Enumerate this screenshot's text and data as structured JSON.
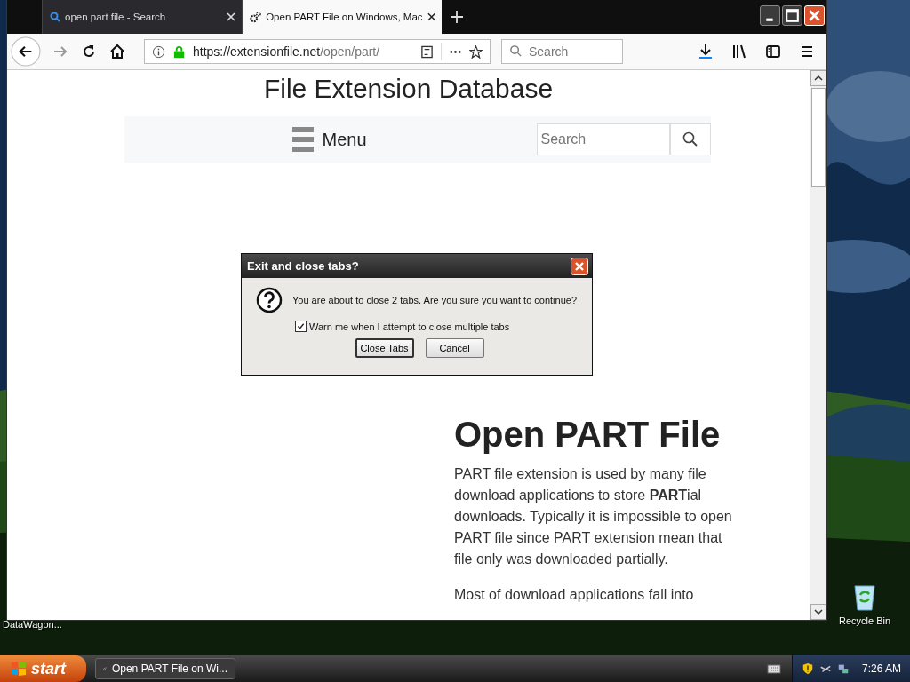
{
  "desktop": {
    "icons": [
      {
        "label": "DataWagon...",
        "kind": "hidden"
      },
      {
        "label": "Recycle Bin",
        "kind": "bin"
      }
    ]
  },
  "browser": {
    "tabs": [
      {
        "title": "open part file - Search",
        "selected": false,
        "kind": "search"
      },
      {
        "title": "Open PART File on Windows, Mac",
        "selected": true,
        "kind": "site"
      }
    ],
    "address": {
      "host": "https://extensionfile.net",
      "path": "/open/part/"
    },
    "search": {
      "placeholder": "Search"
    }
  },
  "page": {
    "site_title": "File Extension Database",
    "menu": "Menu",
    "search": {
      "placeholder": "Search"
    },
    "heading": "Open PART File",
    "paragraphs": [
      "PART file extension is used by many file download applications to store **PART**ial downloads. Typically it is impossible to open PART file since PART extension mean that file only was downloaded partially.",
      "Most of download applications fall into"
    ]
  },
  "dialog": {
    "title": "Exit and close tabs?",
    "message": "You are about to close 2 tabs. Are you sure you want to continue?",
    "checkbox": {
      "label": "Warn me when I attempt to close multiple tabs",
      "checked": true
    },
    "buttons": [
      {
        "label": "Close Tabs",
        "selected": true
      },
      {
        "label": "Cancel",
        "selected": false
      }
    ]
  },
  "taskbar": {
    "start": "start",
    "tasks": [
      {
        "label": "Open PART File on Wi...",
        "selected": false
      }
    ],
    "clock": "7:26 AM"
  }
}
